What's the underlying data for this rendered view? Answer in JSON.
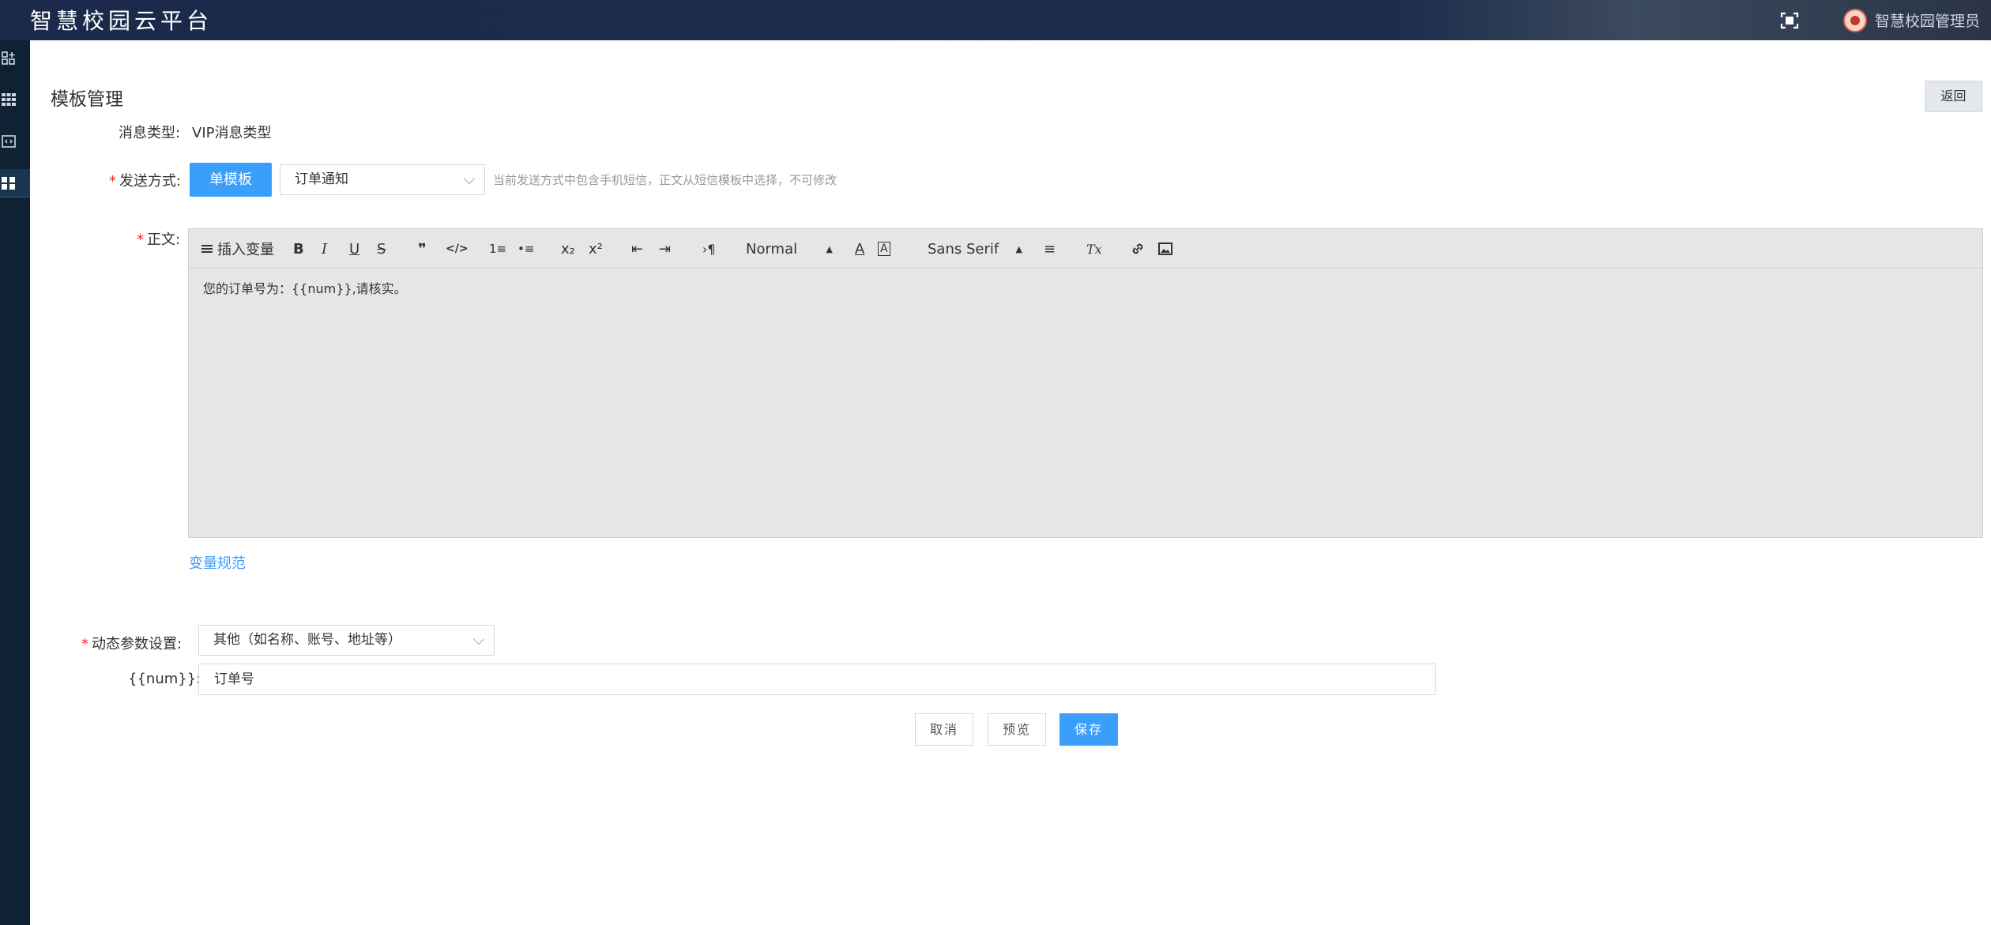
{
  "header": {
    "brand": "智慧校园云平台",
    "username": "智慧校园管理员"
  },
  "page": {
    "title": "模板管理",
    "back_label": "返回"
  },
  "form": {
    "message_type": {
      "label": "消息类型:",
      "value": "VIP消息类型"
    },
    "send_method": {
      "label": "发送方式:",
      "button_label": "单模板",
      "select_value": "订单通知",
      "hint": "当前发送方式中包含手机短信，正文从短信模板中选择，不可修改"
    },
    "body": {
      "label": "正文:",
      "toolbar": {
        "insert_variable": "插入变量",
        "bold": "B",
        "italic": "I",
        "underline": "U",
        "strike": "S",
        "quote": "❞",
        "code": "</>",
        "ordered_list": "1≡",
        "bullet_list": "•≡",
        "subscript": "x₂",
        "superscript": "x²",
        "outdent": "⇤",
        "indent": "⇥",
        "direction": "›¶",
        "size_value": "Normal",
        "color": "A",
        "background": "A",
        "font_value": "Sans Serif",
        "align": "≡",
        "clean": "Tx",
        "link": "🔗",
        "image": "▣"
      },
      "content": "您的订单号为：{{num}},请核实。"
    },
    "variable_spec_link": "变量规范",
    "dynamic_params": {
      "label": "动态参数设置:",
      "param_name": "{{num}}:",
      "param_type": "其他（如名称、账号、地址等）",
      "param_value": "订单号"
    }
  },
  "actions": {
    "cancel": "取消",
    "preview": "预览",
    "save": "保存"
  },
  "colors": {
    "primary": "#3a9efb",
    "topbar": "#1b2a4a",
    "sidebar": "#0f2233",
    "required": "#f5222d"
  }
}
